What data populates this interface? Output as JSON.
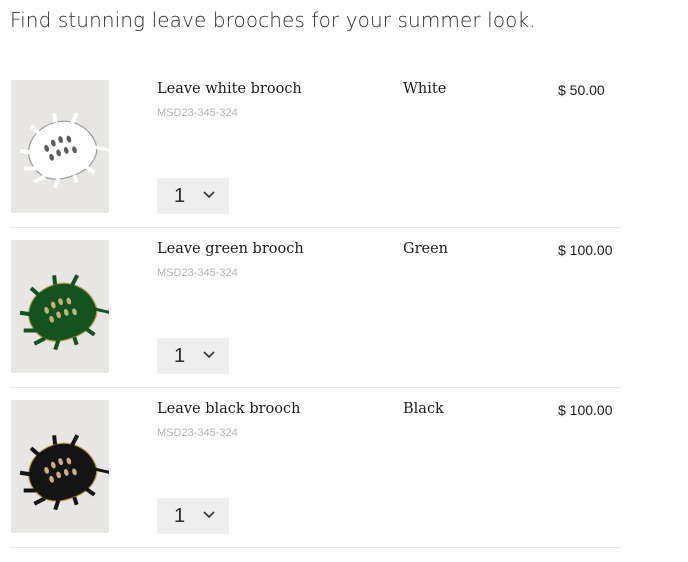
{
  "heading": "Find stunning leave brooches for your summer look.",
  "products": [
    {
      "name": "Leave white brooch",
      "sku": "MSD23-345-324",
      "color": "White",
      "price": "$ 50.00",
      "qty": "1",
      "leaf_color": "#ffffff",
      "leaf_stroke": "#9a9a9a",
      "hole_color": "#5a5a5a"
    },
    {
      "name": "Leave green brooch",
      "sku": "MSD23-345-324",
      "color": "Green",
      "price": "$ 100.00",
      "qty": "1",
      "leaf_color": "#14531f",
      "leaf_stroke": "#b89a52",
      "hole_color": "#c9b07a"
    },
    {
      "name": "Leave black brooch",
      "sku": "MSD23-345-324",
      "color": "Black",
      "price": "$ 100.00",
      "qty": "1",
      "leaf_color": "#141414",
      "leaf_stroke": "#b89a52",
      "hole_color": "#c9b07a"
    }
  ],
  "icons": {
    "product_image": "leaf-brooch-image",
    "dropdown": "chevron-down-icon"
  }
}
